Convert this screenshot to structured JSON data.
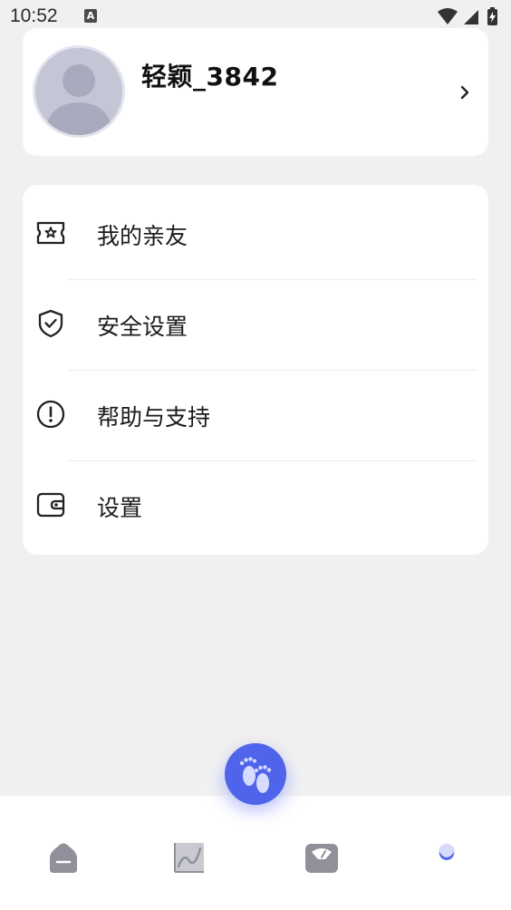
{
  "status_bar": {
    "time": "10:52",
    "notification_letter": "A"
  },
  "profile": {
    "username": "轻颖_3842"
  },
  "menu": {
    "items": [
      {
        "label": "我的亲友",
        "icon": "ticket-star-icon"
      },
      {
        "label": "安全设置",
        "icon": "shield-check-icon"
      },
      {
        "label": "帮助与支持",
        "icon": "exclamation-circle-icon"
      },
      {
        "label": "设置",
        "icon": "wallet-icon"
      }
    ]
  },
  "bottom_nav": {
    "items": [
      {
        "icon": "home-icon",
        "active": false
      },
      {
        "icon": "chart-icon",
        "active": false
      },
      {
        "icon": "scale-icon",
        "active": false
      },
      {
        "icon": "profile-dot-icon",
        "active": true
      }
    ],
    "fab_icon": "baby-footprints-icon"
  },
  "colors": {
    "accent": "#4f64ea",
    "background": "#f1f0f0",
    "nav_inactive": "#9a9ba3"
  }
}
